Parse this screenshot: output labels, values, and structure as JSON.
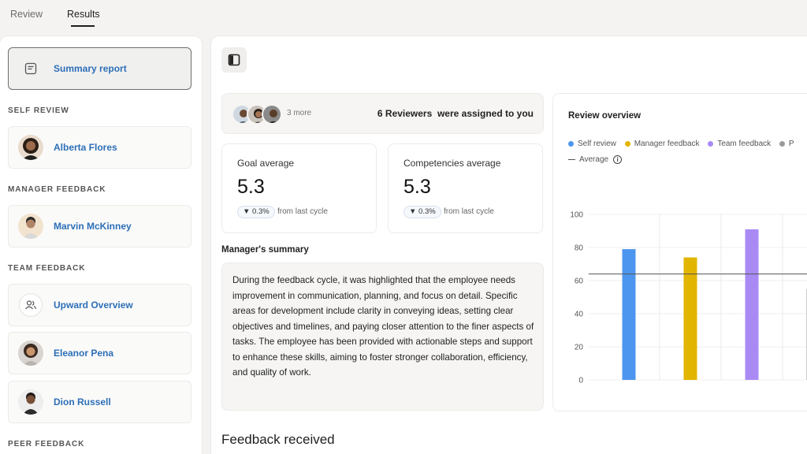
{
  "tabs": [
    {
      "label": "Review"
    },
    {
      "label": "Results"
    }
  ],
  "sidebar": {
    "summary_label": "Summary report",
    "sections": {
      "self_review": "SELF REVIEW",
      "manager_feedback": "MANAGER FEEDBACK",
      "team_feedback": "TEAM FEEDBACK",
      "peer_feedback": "PEER FEEDBACK"
    },
    "items": {
      "alberta": "Alberta Flores",
      "marvin": "Marvin McKinney",
      "upward": "Upward Overview",
      "eleanor": "Eleanor Pena",
      "dion": "Dion Russell"
    }
  },
  "reviewers": {
    "more": "3 more",
    "count_text": "6 Reviewers",
    "assigned_text": "were assigned to you"
  },
  "stats": [
    {
      "title": "Goal average",
      "value": "5.3",
      "change": "0.3%",
      "from": "from last cycle"
    },
    {
      "title": "Competencies average",
      "value": "5.3",
      "change": "0.3%",
      "from": "from last cycle"
    }
  ],
  "manager_summary": {
    "title": "Manager's summary",
    "text": "During the feedback cycle, it was highlighted that the employee needs improvement in communication, planning, and focus on detail. Specific areas for development include clarity in conveying ideas, setting clear objectives and timelines, and paying closer attention to the finer aspects of tasks. The employee has been provided with actionable steps and support to enhance these skills, aiming to foster stronger collaboration, efficiency, and quality of work."
  },
  "feedback_received": "Feedback received",
  "chart_data": {
    "type": "bar",
    "title": "Review overview",
    "categories": [
      "Self review",
      "Manager feedback",
      "Team feedback",
      "P"
    ],
    "values": [
      79,
      74,
      91,
      55
    ],
    "colors": [
      "#4d96ef",
      "#e2b500",
      "#a98af5",
      "#9a9a9a"
    ],
    "average": 64,
    "average_label": "Average",
    "ylim": [
      0,
      100
    ],
    "yticks": [
      0,
      20,
      40,
      60,
      80,
      100
    ],
    "legend_placement": "top"
  }
}
